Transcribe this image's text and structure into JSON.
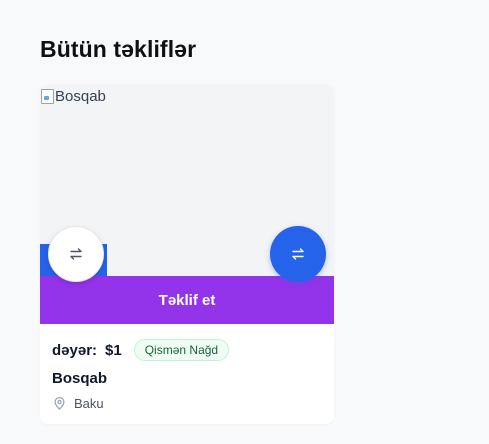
{
  "page": {
    "title": "Bütün təkliflər"
  },
  "card": {
    "image_alt": "Bosqab",
    "offer_button_label": "Təklif et",
    "value_label": "dəyər:",
    "price": "$1",
    "badge": "Qismən Nağd",
    "item_name": "Bosqab",
    "location": "Baku"
  },
  "icons": {
    "swap_left": "swap-arrows-icon",
    "swap_right": "swap-arrows-icon",
    "location": "map-pin-icon",
    "broken_image": "broken-image-icon"
  },
  "colors": {
    "background": "#f8f9fb",
    "primary_blue": "#2563eb",
    "offer_purple": "#9333ea",
    "badge_green_text": "#166534",
    "badge_green_bg": "#f0fdf4"
  }
}
